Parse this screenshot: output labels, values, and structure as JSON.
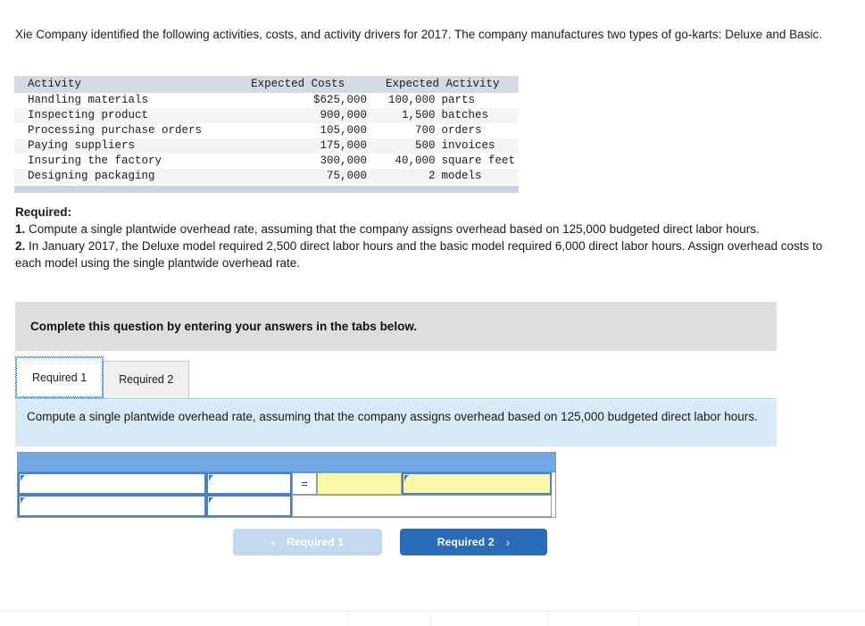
{
  "intro": {
    "text": "Xie Company identified the following activities, costs, and activity drivers for 2017. The company manufactures two types of go-karts: Deluxe and Basic."
  },
  "activity_table": {
    "headers": {
      "activity": "Activity",
      "expected_costs": "Expected Costs",
      "expected_activity": "Expected Activity"
    },
    "rows": [
      {
        "activity": "Handling materials",
        "cost": "$625,000",
        "qty": "100,000",
        "unit": "parts"
      },
      {
        "activity": "Inspecting product",
        "cost": "900,000",
        "qty": "1,500",
        "unit": "batches"
      },
      {
        "activity": "Processing purchase orders",
        "cost": "105,000",
        "qty": "700",
        "unit": "orders"
      },
      {
        "activity": "Paying suppliers",
        "cost": "175,000",
        "qty": "500",
        "unit": "invoices"
      },
      {
        "activity": "Insuring the factory",
        "cost": "300,000",
        "qty": "40,000",
        "unit": "square feet"
      },
      {
        "activity": "Designing packaging",
        "cost": "75,000",
        "qty": "2",
        "unit": "models"
      }
    ]
  },
  "required": {
    "label": "Required:",
    "item1_number": "1.",
    "item1_text": " Compute a single plantwide overhead rate, assuming that the company assigns overhead based on 125,000 budgeted direct labor hours.",
    "item2_number": "2.",
    "item2_text": " In January 2017, the Deluxe model required 2,500 direct labor hours and the basic model required 6,000 direct labor hours. Assign overhead costs to each model using the single plantwide overhead rate."
  },
  "banner": {
    "text": "Complete this question by entering your answers in the tabs below."
  },
  "tabs": [
    {
      "label": "Required 1",
      "active": true
    },
    {
      "label": "Required 2",
      "active": false
    }
  ],
  "instruction_panel": {
    "text": "Compute a single plantwide overhead rate, assuming that the company assigns overhead based on 125,000 budgeted direct labor hours."
  },
  "answer_grid": {
    "equals_symbol": "=",
    "row1": {
      "label_cell": "",
      "value_cell": "",
      "result_cell": "",
      "result_unit_cell": ""
    },
    "row2": {
      "label_cell": "",
      "value_cell": "",
      "blank_cell": ""
    }
  },
  "nav": {
    "prev_label": "Required 1",
    "prev_chevron": "‹",
    "next_label": "Required 2",
    "next_chevron": "›"
  },
  "colors": {
    "grid_header_blue": "#6fa8e4",
    "panel_blue": "#d6eaf8",
    "banner_grey": "#dedede",
    "table_header": "#d4d9e6",
    "yellow_cell": "#f8f8a8",
    "next_button": "#2b6cb8",
    "prev_button": "#c3d9f0"
  }
}
